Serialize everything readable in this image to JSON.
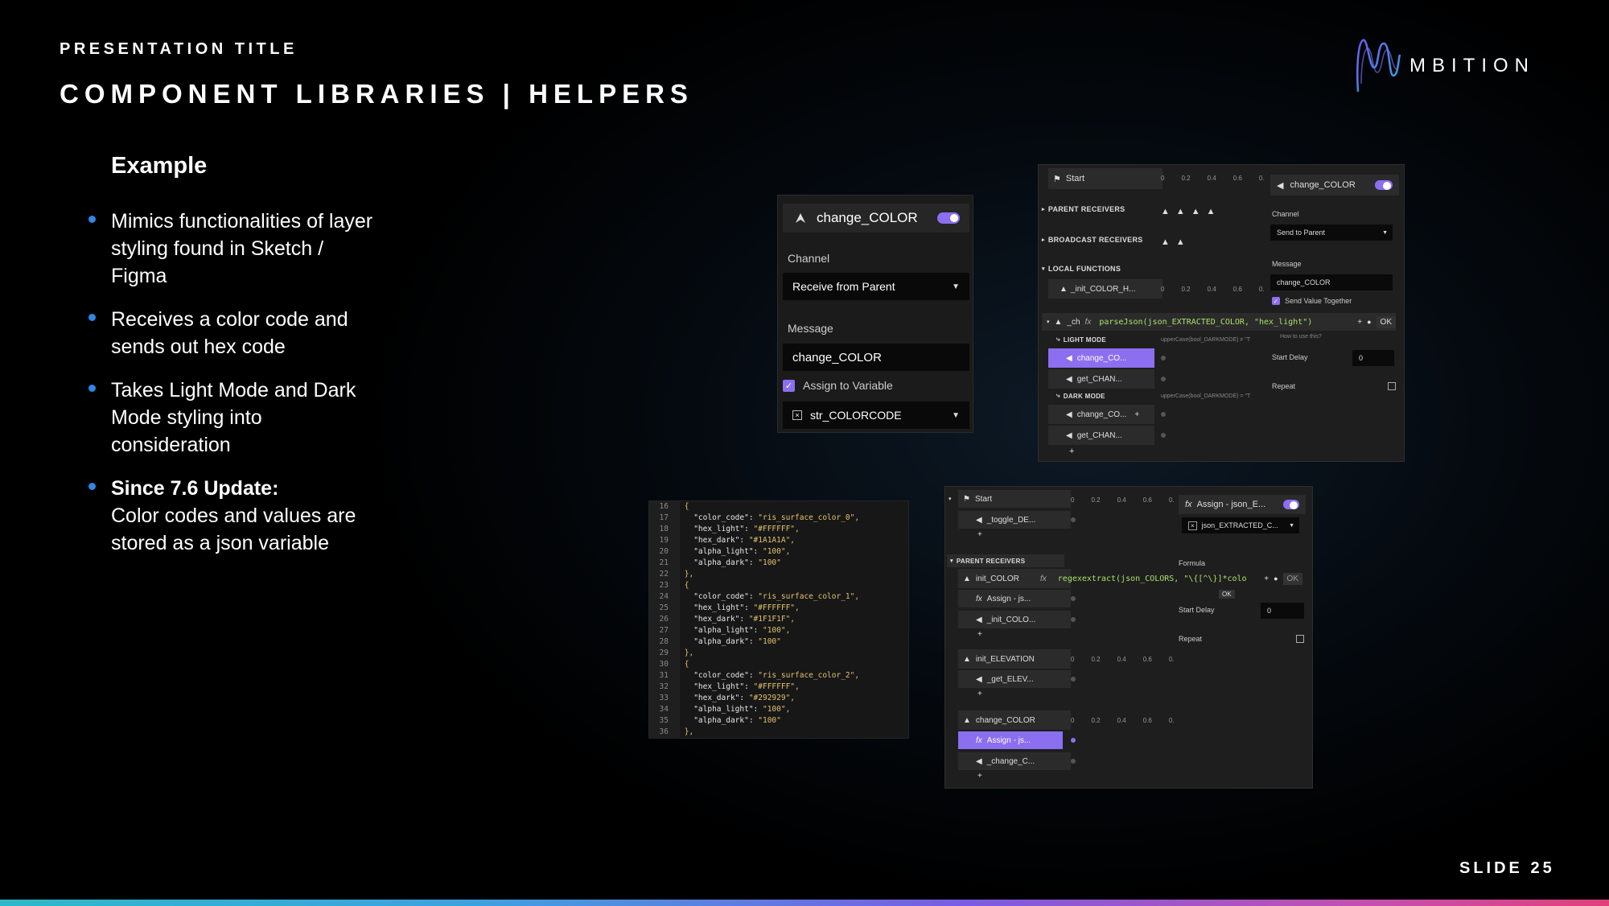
{
  "slide": {
    "presentation_title": "PRESENTATION TITLE",
    "main_title": "COMPONENT LIBRARIES | HELPERS",
    "brand": "MBITION",
    "slide_number": "SLIDE 25",
    "example_heading": "Example",
    "bullets": [
      {
        "bold": "",
        "text": "Mimics functionalities of layer styling found in Sketch / Figma"
      },
      {
        "bold": "",
        "text": "Receives a color code and sends out hex code"
      },
      {
        "bold": "",
        "text": "Takes Light Mode and Dark Mode styling into consideration"
      },
      {
        "bold": "Since 7.6 Update:",
        "text": "Color codes and values are stored as a json variable"
      }
    ]
  },
  "colors": {
    "accent": "#8b6ff0",
    "bullet": "#2f86e6"
  },
  "panel_receive": {
    "title": "change_COLOR",
    "channel_label": "Channel",
    "channel_value": "Receive from Parent",
    "message_label": "Message",
    "message_value": "change_COLOR",
    "assign_label": "Assign to Variable",
    "variable_value": "str_COLORCODE"
  },
  "panel_send": {
    "start": "Start",
    "ticks": [
      "0",
      "0.2",
      "0.4",
      "0.6",
      "0."
    ],
    "parent_receivers": "PARENT RECEIVERS",
    "broadcast_receivers": "BROADCAST RECEIVERS",
    "local_functions": "LOCAL FUNCTIONS",
    "init_fn": "_init_COLOR_H...",
    "ch_fn": "_ch",
    "formula": "parseJson(json_EXTRACTED_COLOR, \"hex_light\")",
    "ok": "OK",
    "how_to": "How to use this?",
    "light_mode": "LIGHT MODE",
    "dark_mode": "DARK MODE",
    "light_cond": "upperCase(bool_DARKMODE) ≠ \"T",
    "dark_cond": "upperCase(bool_DARKMODE) = \"T",
    "items": [
      "change_CO...",
      "get_CHAN...",
      "change_CO...",
      "get_CHAN..."
    ],
    "plus": "+",
    "inspector_title": "change_COLOR",
    "channel_label": "Channel",
    "channel_value": "Send to Parent",
    "message_label": "Message",
    "message_value": "change_COLOR",
    "send_together": "Send Value Together",
    "start_delay_label": "Start Delay",
    "start_delay_value": "0",
    "repeat_label": "Repeat"
  },
  "code": {
    "lines": [
      {
        "n": "16",
        "t": "{"
      },
      {
        "n": "17",
        "k": "\"color_code\":",
        "v": " \"ris_surface_color_0\","
      },
      {
        "n": "18",
        "k": "\"hex_light\":",
        "v": " \"#FFFFFF\","
      },
      {
        "n": "19",
        "k": "\"hex_dark\":",
        "v": " \"#1A1A1A\","
      },
      {
        "n": "20",
        "k": "\"alpha_light\":",
        "v": " \"100\","
      },
      {
        "n": "21",
        "k": "\"alpha_dark\":",
        "v": " \"100\""
      },
      {
        "n": "22",
        "t": "},"
      },
      {
        "n": "23",
        "t": "{"
      },
      {
        "n": "24",
        "k": "\"color_code\":",
        "v": " \"ris_surface_color_1\","
      },
      {
        "n": "25",
        "k": "\"hex_light\":",
        "v": " \"#FFFFFF\","
      },
      {
        "n": "26",
        "k": "\"hex_dark\":",
        "v": " \"#1F1F1F\","
      },
      {
        "n": "27",
        "k": "\"alpha_light\":",
        "v": " \"100\","
      },
      {
        "n": "28",
        "k": "\"alpha_dark\":",
        "v": " \"100\""
      },
      {
        "n": "29",
        "t": "},"
      },
      {
        "n": "30",
        "t": "{"
      },
      {
        "n": "31",
        "k": "\"color_code\":",
        "v": " \"ris_surface_color_2\","
      },
      {
        "n": "32",
        "k": "\"hex_light\":",
        "v": " \"#FFFFFF\","
      },
      {
        "n": "33",
        "k": "\"hex_dark\":",
        "v": " \"#292929\","
      },
      {
        "n": "34",
        "k": "\"alpha_light\":",
        "v": " \"100\","
      },
      {
        "n": "35",
        "k": "\"alpha_dark\":",
        "v": " \"100\""
      },
      {
        "n": "36",
        "t": "},"
      }
    ]
  },
  "panel_extract": {
    "start": "Start",
    "toggle_item": "_toggle_DE...",
    "parent_receivers": "PARENT RECEIVERS",
    "init_color": "init_COLOR",
    "assign_js": "Assign - js...",
    "init_colo": "_init_COLO...",
    "init_elevation": "init_ELEVATION",
    "get_elev": "_get_ELEV...",
    "change_color": "change_COLOR",
    "assign_js2": "Assign - js...",
    "change_c": "_change_C...",
    "plus": "+",
    "ticks": [
      "0",
      "0.2",
      "0.4",
      "0.6",
      "0."
    ],
    "formula": "regexextract(json_COLORS, \"\\{[^\\}]*colo",
    "ok": "OK",
    "ok_tip": "OK",
    "inspector_title": "Assign - json_E...",
    "variable_value": "json_EXTRACTED_C...",
    "formula_label": "Formula",
    "start_delay_label": "Start Delay",
    "start_delay_value": "0",
    "repeat_label": "Repeat"
  }
}
